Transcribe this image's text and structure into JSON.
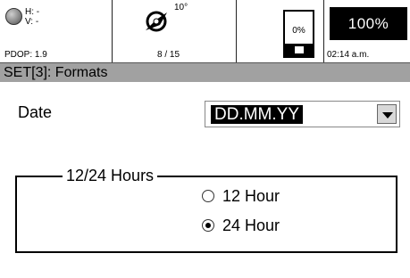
{
  "status": {
    "gps_h": "H: -",
    "gps_v": "V: -",
    "pdop": "PDOP: 1.9",
    "compass_deg": "10°",
    "satellites": "8 / 15",
    "memory_pct": "0%",
    "battery_pct": "100%",
    "clock": "02:14 a.m.",
    "icons": {
      "gps": "gps-signal-icon",
      "compass": "compass-icon",
      "memory": "memory-card-icon"
    }
  },
  "title": "SET[3]: Formats",
  "date": {
    "label": "Date",
    "selected": "DD.MM.YY"
  },
  "time_format": {
    "legend": "12/24 Hours",
    "options": [
      {
        "label": "12 Hour",
        "checked": false
      },
      {
        "label": "24 Hour",
        "checked": true
      }
    ]
  }
}
